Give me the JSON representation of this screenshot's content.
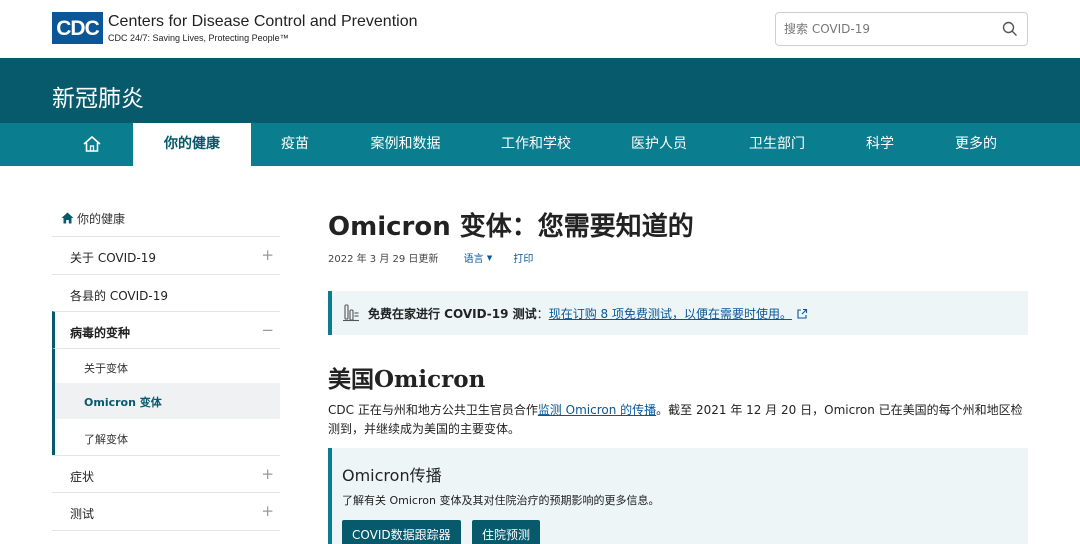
{
  "header": {
    "logo_text": "CDC",
    "brand_title": "Centers for Disease Control and Prevention",
    "brand_tagline": "CDC 24/7: Saving Lives, Protecting People™",
    "search_placeholder": "搜索 COVID-19"
  },
  "banner": {
    "title": "新冠肺炎"
  },
  "nav": {
    "items": [
      "你的健康",
      "疫苗",
      "案例和数据",
      "工作和学校",
      "医护人员",
      "卫生部门",
      "科学",
      "更多的"
    ],
    "active_index": 0
  },
  "sidebar": {
    "home_label": "你的健康",
    "items": [
      {
        "label": "关于 COVID-19",
        "sign": "+"
      },
      {
        "label": "各县的 COVID-19",
        "sign": ""
      },
      {
        "label": "病毒的变种",
        "sign": "−"
      }
    ],
    "subitems": [
      "关于变体",
      "Omicron 变体",
      "了解变体"
    ],
    "current_subitem": 1,
    "after_items": [
      {
        "label": "症状",
        "sign": "+"
      },
      {
        "label": "测试",
        "sign": "+"
      }
    ]
  },
  "main": {
    "title": "Omicron 变体：您需要知道的",
    "updated": "2022 年 3 月 29 日更新",
    "language_link": "语言",
    "print_link": "打印",
    "alert": {
      "bold": "免费在家进行 COVID-19 测试",
      "sep": "：",
      "link": "现在订购 8 项免费测试，以便在需要时使用。"
    },
    "section_title": "美国Omicron",
    "paragraph": {
      "before": "CDC 正在与州和地方公共卫生官员合作",
      "link": "监测 Omicron 的传播",
      "after": "。截至 2021 年 12 月 20 日，Omicron 已在美国的每个州和地区检测到，并继续成为美国的主要变体。"
    },
    "card": {
      "title": "Omicron传播",
      "desc": "了解有关 Omicron 变体及其对住院治疗的预期影响的更多信息。",
      "buttons": [
        "COVID数据跟踪器",
        "住院预测"
      ]
    }
  },
  "colors": {
    "brand_blue": "#0b5697",
    "banner_teal": "#075a6c",
    "nav_teal": "#0a7d8e",
    "link_blue": "#0b5697",
    "callout_bg": "#edf5f6"
  }
}
